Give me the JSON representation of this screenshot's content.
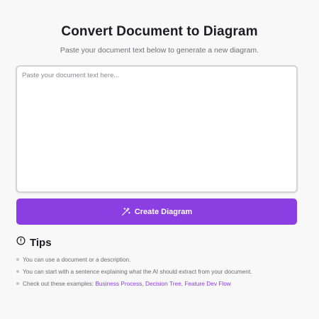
{
  "header": {
    "title": "Convert Document to Diagram",
    "subtitle": "Paste your document text below to generate a new diagram."
  },
  "editor": {
    "value": "",
    "placeholder": "Paste your document text here..."
  },
  "actions": {
    "create_label": "Create Diagram",
    "create_icon": "magic-wand-icon",
    "accent_color": "#8b3fe2"
  },
  "tips": {
    "title": "Tips",
    "icon": "info-icon",
    "items": [
      "You can use a document or a description.",
      "You can start with a sentence explaining what the AI should extract from your document."
    ],
    "examples_prefix": "Check out these examples: ",
    "examples": [
      "Business Process",
      "Decision Tree",
      "Feature Dev Flow"
    ],
    "separator": ", "
  }
}
